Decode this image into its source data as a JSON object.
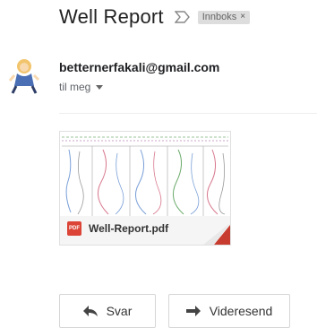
{
  "email": {
    "subject": "Well Report",
    "label": "Innboks",
    "label_remove": "×",
    "sender": "betternerfakali@gmail.com",
    "recipient": "til meg"
  },
  "attachment": {
    "filename": "Well-Report.pdf",
    "icon_text": "PDF"
  },
  "actions": {
    "reply": "Svar",
    "forward": "Videresend"
  },
  "colors": {
    "pdf_red": "#db4437",
    "corner_red": "#db4437"
  }
}
